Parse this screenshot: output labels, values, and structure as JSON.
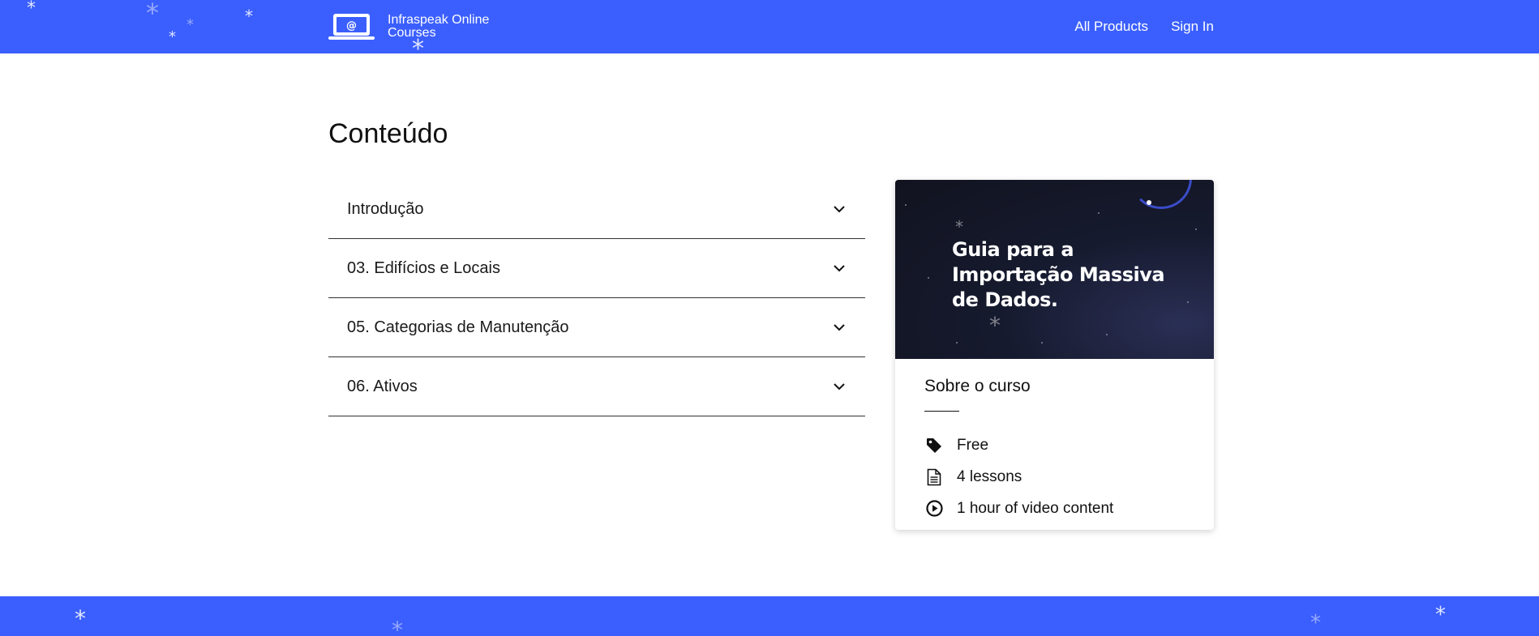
{
  "header": {
    "brand_name": "Infraspeak Online Courses",
    "logo_icon": "laptop-at-icon",
    "nav": {
      "all_products": "All Products",
      "sign_in": "Sign In"
    }
  },
  "main": {
    "title": "Conteúdo",
    "chapters": [
      {
        "label": "Introdução"
      },
      {
        "label": "03. Edifícios e Locais"
      },
      {
        "label": "05. Categorias de Manutenção"
      },
      {
        "label": "06. Ativos"
      }
    ]
  },
  "course_card": {
    "image_title": "Guia para a Importação Massiva de Dados.",
    "about_title": "Sobre o curso",
    "price": "Free",
    "lessons": "4 lessons",
    "video": "1 hour of video content"
  },
  "colors": {
    "brand_blue": "#3b5ffe",
    "card_dark": "#161a2e"
  }
}
